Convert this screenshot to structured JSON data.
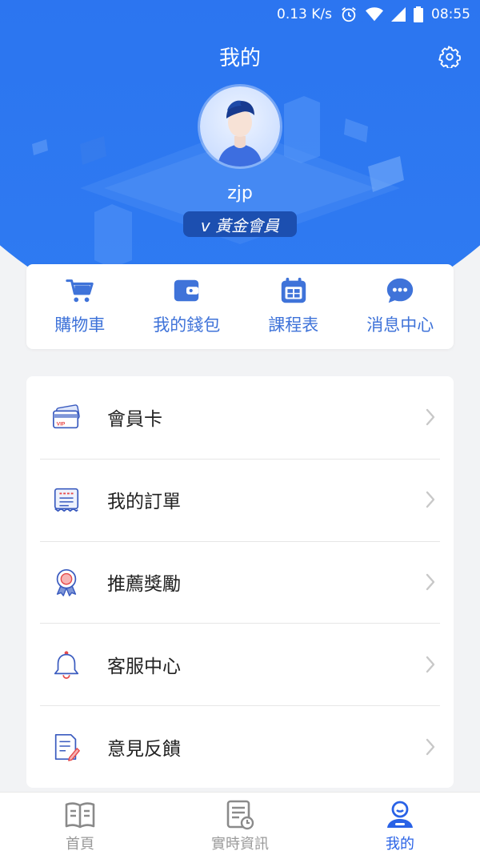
{
  "status_bar": {
    "speed": "0.13 K/s",
    "time": "08:55"
  },
  "header": {
    "title": "我的"
  },
  "profile": {
    "username": "zjp",
    "member_level": "v 黃金會員"
  },
  "quick_actions": [
    {
      "label": "購物車",
      "icon": "cart-icon"
    },
    {
      "label": "我的錢包",
      "icon": "wallet-icon"
    },
    {
      "label": "課程表",
      "icon": "calendar-icon"
    },
    {
      "label": "消息中心",
      "icon": "chat-icon"
    }
  ],
  "menu": [
    {
      "label": "會員卡",
      "icon": "vip-card-icon"
    },
    {
      "label": "我的訂單",
      "icon": "receipt-icon"
    },
    {
      "label": "推薦獎勵",
      "icon": "award-icon"
    },
    {
      "label": "客服中心",
      "icon": "bell-icon"
    },
    {
      "label": "意見反饋",
      "icon": "feedback-icon"
    }
  ],
  "bottom_nav": [
    {
      "label": "首頁",
      "icon": "book-icon",
      "active": false
    },
    {
      "label": "實時資訊",
      "icon": "news-icon",
      "active": false
    },
    {
      "label": "我的",
      "icon": "user-icon",
      "active": true
    }
  ],
  "colors": {
    "primary": "#2962e6",
    "accent_text": "#3f73d9",
    "badge": "#1c4fb0"
  }
}
